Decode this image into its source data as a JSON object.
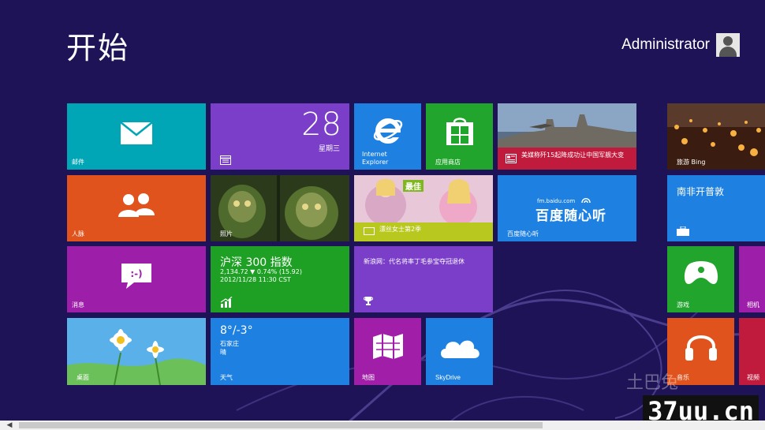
{
  "start": {
    "title": "开始"
  },
  "user": {
    "name": "Administrator"
  },
  "tiles": {
    "mail": {
      "label": "邮件",
      "color": "#00a6b6"
    },
    "calendar": {
      "day": "28",
      "weekday": "星期三",
      "color": "#7a3ec8"
    },
    "ie": {
      "label": "Internet Explorer",
      "color": "#1e80e0"
    },
    "store": {
      "label": "应用商店",
      "color": "#21a52c"
    },
    "news": {
      "headline": "美媒称歼15起降成功让中国军舰大变",
      "color": "#c01a3c"
    },
    "people": {
      "label": "人脉",
      "color": "#e0531c"
    },
    "photos": {
      "label": "照片",
      "color": "#3c6b2a"
    },
    "music_banner": {
      "label": "漂丝女士第2季",
      "tag": "最佳",
      "color": "#b8c81e"
    },
    "baidu": {
      "label": "百度随心听",
      "logo_text": "百度随心听",
      "url": "fm.baidu.com",
      "color": "#1e80e0"
    },
    "messaging": {
      "label": "消息",
      "color": "#9d1ea8"
    },
    "finance": {
      "title": "沪深 300 指数",
      "line1": "2,134.72 ▼ 0.74% (15.92)",
      "line2": "2012/11/28 11:30 CST",
      "color": "#1ea024"
    },
    "sports": {
      "headline": "新浪网：代名将率丁毛参宝夺冠退休",
      "color": "#7a3ec8"
    },
    "desktop": {
      "label": "桌面",
      "color": "#2a80d0"
    },
    "weather": {
      "temp": "8°/-3°",
      "city": "石家庄",
      "condition": "晴",
      "label": "天气",
      "color": "#1e80e0"
    },
    "maps": {
      "label": "地图",
      "color": "#a01ea8"
    },
    "skydrive": {
      "label": "SkyDrive",
      "color": "#1e80e0"
    },
    "travel": {
      "label": "旅游 Bing",
      "color": "#6a3c20"
    },
    "travel2": {
      "label": "南非开普敦",
      "color": "#1e80e0"
    },
    "games": {
      "label": "游戏",
      "color": "#21a52c"
    },
    "camera": {
      "label": "相机",
      "color": "#9d1ea8"
    },
    "music": {
      "label": "音乐",
      "color": "#e0531c"
    },
    "video": {
      "label": "视频",
      "color": "#c01a3c"
    }
  },
  "watermark": {
    "text": "37uu.cn",
    "badge": "土巴兔"
  }
}
